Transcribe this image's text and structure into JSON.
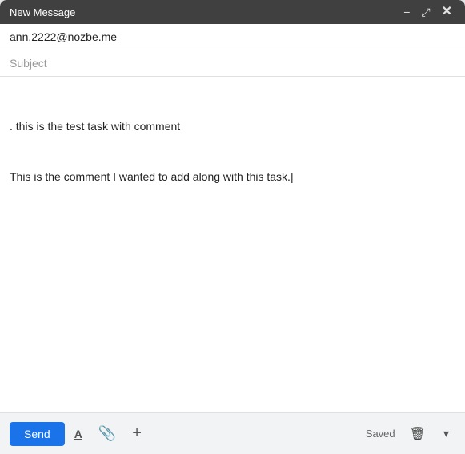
{
  "header": {
    "title": "New Message",
    "minimize_label": "−",
    "resize_label": "⤢",
    "close_label": "✕"
  },
  "to_field": {
    "value": "ann.2222@nozbe.me",
    "placeholder": ""
  },
  "subject_field": {
    "value": "",
    "placeholder": "Subject"
  },
  "body": {
    "line1": ". this is the test task with comment",
    "line2": "This is the comment I wanted to add along with this task.|"
  },
  "footer": {
    "send_label": "Send",
    "saved_label": "Saved",
    "format_text_label": "A",
    "attach_label": "📎",
    "more_label": "+",
    "delete_label": "🗑",
    "more_options_label": "▾"
  }
}
